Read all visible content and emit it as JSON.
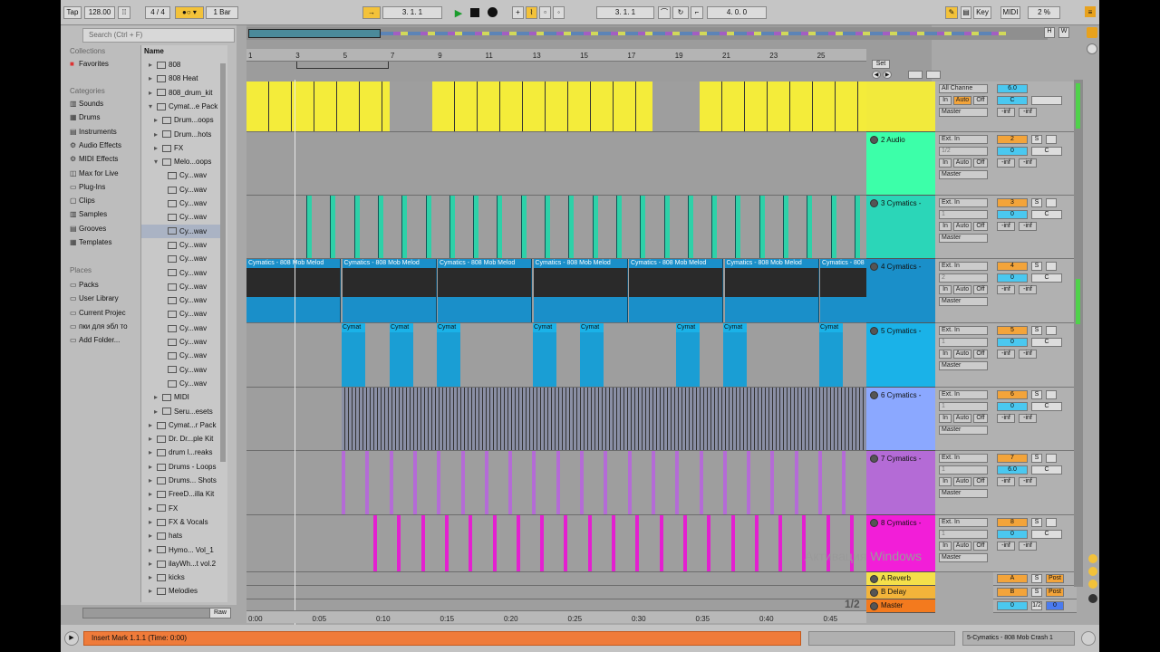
{
  "transport": {
    "tap": "Tap",
    "tempo": "128.00",
    "sig": "4 / 4",
    "quant": "1 Bar",
    "pos": "3.  1.  1",
    "loop_start": "3.  1.  1",
    "loop_len": "4.  0.  0",
    "key": "Key",
    "midi": "MIDI",
    "cpu": "2 %",
    "h": "H",
    "w": "W"
  },
  "browser": {
    "search_placeholder": "Search (Ctrl + F)",
    "collections_title": "Collections",
    "favorites": "Favorites",
    "categories_title": "Categories",
    "categories": [
      "Sounds",
      "Drums",
      "Instruments",
      "Audio Effects",
      "MIDI Effects",
      "Max for Live",
      "Plug-Ins",
      "Clips",
      "Samples",
      "Grooves",
      "Templates"
    ],
    "places_title": "Places",
    "places": [
      "Packs",
      "User Library",
      "Current Projec",
      "пки для эбл то",
      "Add Folder..."
    ],
    "name_header": "Name",
    "files": [
      "808",
      "808 Heat",
      "808_drum_kit",
      "Cymat...e Pack",
      "Drum...oops",
      "Drum...hots",
      "FX",
      "Melo...oops",
      "Cy...wav",
      "Cy...wav",
      "Cy...wav",
      "Cy...wav",
      "Cy...wav",
      "Cy...wav",
      "Cy...wav",
      "Cy...wav",
      "Cy...wav",
      "Cy...wav",
      "Cy...wav",
      "Cy...wav",
      "Cy...wav",
      "Cy...wav",
      "Cy...wav",
      "Cy...wav",
      "MIDI",
      "Seru...esets",
      "Cymat...r Pack",
      "Dr. Dr...ple Kit",
      "drum l...reaks",
      "Drums - Loops",
      "Drums... Shots",
      "FreeD...illa Kit",
      "FX",
      "FX & Vocals",
      "hats",
      "Hymo... Vol_1",
      "ilayWh...t vol.2",
      "kicks",
      "Melodies"
    ],
    "raw": "Raw"
  },
  "ruler": [
    "1",
    "3",
    "5",
    "7",
    "9",
    "11",
    "13",
    "15",
    "17",
    "19",
    "21",
    "23",
    "25"
  ],
  "set_label": "Set",
  "tracks": [
    {
      "name": "",
      "input": "All Channe",
      "output": "Master",
      "num": "6.0",
      "vol": "C",
      "inf1": "-inf",
      "inf2": "-inf"
    },
    {
      "name": "2 Audio",
      "input": "Ext. In",
      "sub": "1/2",
      "output": "Master",
      "num": "2",
      "vol": "0",
      "pan": "C",
      "inf1": "-inf",
      "inf2": "-inf"
    },
    {
      "name": "3 Cymatics -",
      "input": "Ext. In",
      "sub": "1",
      "output": "Master",
      "num": "3",
      "vol": "0",
      "pan": "C",
      "inf1": "-inf",
      "inf2": "-inf"
    },
    {
      "name": "4 Cymatics -",
      "input": "Ext. In",
      "sub": "2",
      "output": "Master",
      "num": "4",
      "vol": "0",
      "pan": "C",
      "inf1": "-inf",
      "inf2": "-inf"
    },
    {
      "name": "5 Cymatics -",
      "input": "Ext. In",
      "sub": "1",
      "output": "Master",
      "num": "5",
      "vol": "0",
      "pan": "C",
      "inf1": "-inf",
      "inf2": "-inf"
    },
    {
      "name": "6 Cymatics -",
      "input": "Ext. In",
      "sub": "1",
      "output": "Master",
      "num": "6",
      "vol": "0",
      "pan": "C",
      "inf1": "-inf",
      "inf2": "-inf"
    },
    {
      "name": "7 Cymatics -",
      "input": "Ext. In",
      "sub": "1",
      "output": "Master",
      "num": "7",
      "vol": "6.0",
      "pan": "C",
      "inf1": "-inf",
      "inf2": "-inf"
    },
    {
      "name": "8 Cymatics -",
      "input": "Ext. In",
      "sub": "1",
      "output": "Master",
      "num": "8",
      "vol": "0",
      "pan": "C",
      "inf1": "-inf",
      "inf2": "-inf"
    }
  ],
  "returns": [
    {
      "name": "A Reverb",
      "num": "A",
      "s": "S",
      "post": "Post"
    },
    {
      "name": "B Delay",
      "num": "B",
      "s": "S",
      "post": "Post"
    },
    {
      "name": "Master",
      "num": "0",
      "s": "1/2",
      "post": "0"
    }
  ],
  "clip_label": "Cymatics - 808 Mob Melod",
  "clip_label_short": "Cymat",
  "time_labels": [
    "0:00",
    "0:05",
    "0:10",
    "0:15",
    "0:20",
    "0:25",
    "0:30",
    "0:35",
    "0:40",
    "0:45"
  ],
  "page": "1/2",
  "watermark1": "Активация Windows",
  "status": "Insert Mark 1.1.1 (Time: 0:00)",
  "status_right": "5-Cymatics - 808 Mob Crash 1",
  "btn_s": "S",
  "btn_in": "In",
  "btn_auto": "Auto",
  "btn_off": "Off"
}
